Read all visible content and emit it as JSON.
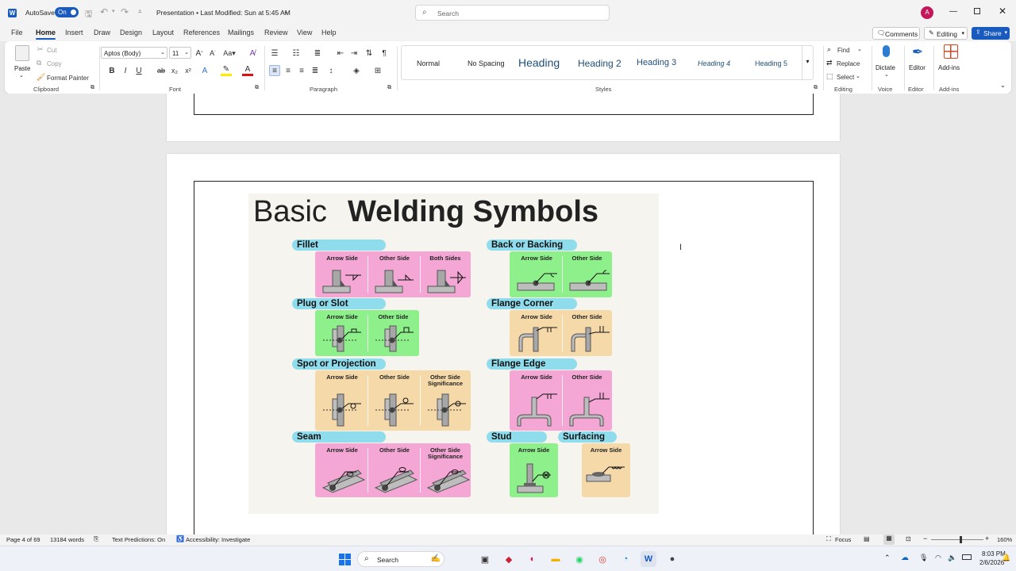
{
  "titlebar": {
    "autosave_label": "AutoSave",
    "autosave_state": "On",
    "doc_title": "Presentation • Last Modified: Sun at 5:45 AM",
    "search_placeholder": "Search",
    "avatar_initial": "A"
  },
  "menu": {
    "tabs": [
      "File",
      "Home",
      "Insert",
      "Draw",
      "Design",
      "Layout",
      "References",
      "Mailings",
      "Review",
      "View",
      "Help"
    ],
    "active": "Home",
    "comments_label": "Comments",
    "editing_label": "Editing",
    "share_label": "Share"
  },
  "ribbon": {
    "clipboard": {
      "paste": "Paste",
      "cut": "Cut",
      "copy": "Copy",
      "format_painter": "Format Painter",
      "group": "Clipboard"
    },
    "font": {
      "family": "Aptos (Body)",
      "size": "11",
      "group": "Font"
    },
    "paragraph": {
      "group": "Paragraph"
    },
    "styles": {
      "items": [
        "Normal",
        "No Spacing",
        "Heading",
        "Heading 2",
        "Heading 3",
        "Heading 4",
        "Heading 5"
      ],
      "group": "Styles"
    },
    "editing": {
      "find": "Find",
      "replace": "Replace",
      "select": "Select",
      "group": "Editing"
    },
    "voice": {
      "dictate": "Dictate",
      "group": "Voice"
    },
    "editor": {
      "label": "Editor",
      "group": "Editor"
    },
    "addins": {
      "label": "Add-ins",
      "group": "Add-ins"
    }
  },
  "infographic": {
    "title_light": "Basic",
    "title_bold": "Welding Symbols",
    "sections": {
      "fillet": {
        "label": "Fillet",
        "cells": [
          "Arrow Side",
          "Other Side",
          "Both Sides"
        ]
      },
      "backing": {
        "label": "Back or Backing",
        "cells": [
          "Arrow Side",
          "Other Side"
        ]
      },
      "plug": {
        "label": "Plug or Slot",
        "cells": [
          "Arrow Side",
          "Other Side"
        ]
      },
      "flange_corner": {
        "label": "Flange Corner",
        "cells": [
          "Arrow Side",
          "Other Side"
        ]
      },
      "spot": {
        "label": "Spot or Projection",
        "cells": [
          "Arrow Side",
          "Other Side",
          "Other Side Significance"
        ]
      },
      "flange_edge": {
        "label": "Flange Edge",
        "cells": [
          "Arrow Side",
          "Other Side"
        ]
      },
      "seam": {
        "label": "Seam",
        "cells": [
          "Arrow Side",
          "Other Side",
          "Other Side Significance"
        ]
      },
      "stud": {
        "label": "Stud",
        "cells": [
          "Arrow Side"
        ]
      },
      "surfacing": {
        "label": "Surfacing",
        "cells": [
          "Arrow Side"
        ]
      }
    }
  },
  "status": {
    "page": "Page 4 of 69",
    "words": "13184 words",
    "text_predictions": "Text Predictions: On",
    "accessibility": "Accessibility: Investigate",
    "focus": "Focus",
    "zoom": "160%"
  },
  "taskbar": {
    "search_label": "Search",
    "time": "8:03 PM",
    "date": "2/6/2026"
  }
}
